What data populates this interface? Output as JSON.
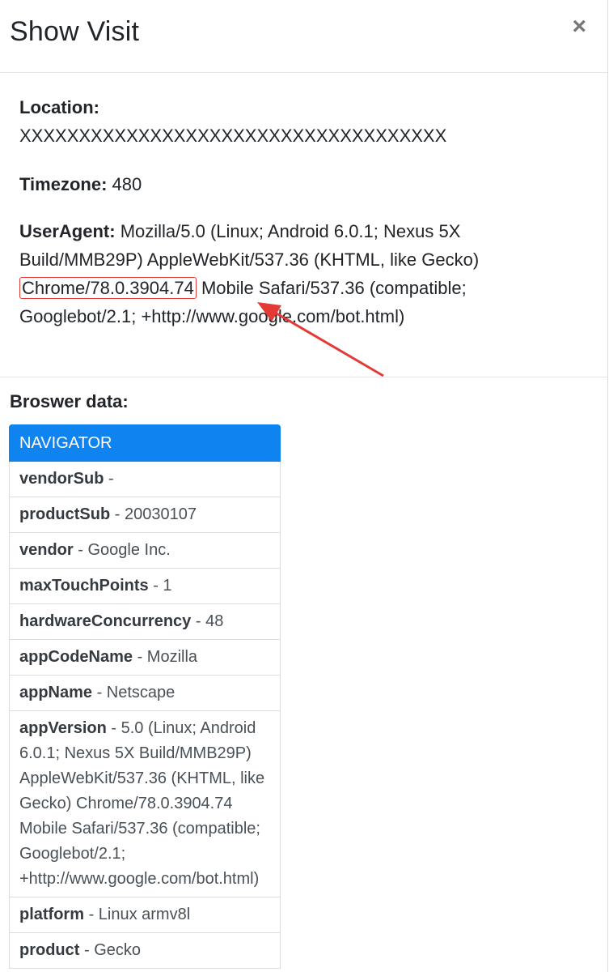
{
  "modal": {
    "title": "Show Visit",
    "close_label": "×"
  },
  "location": {
    "label": "Location:",
    "value": "XXXXXXXXXXXXXXXXXXXXXXXXXXXXXXXXXXXX"
  },
  "timezone": {
    "label": "Timezone:",
    "value": "480"
  },
  "useragent": {
    "label": "UserAgent:",
    "part1": "Mozilla/5.0 (Linux; Android 6.0.1; Nexus 5X Build/MMB29P) AppleWebKit/537.36 (KHTML, like Gecko)",
    "highlight": "Chrome/78.0.3904.74",
    "part2": "Mobile Safari/537.36 (compatible; Googlebot/2.1; +http://www.google.com/bot.html)"
  },
  "browser": {
    "title": "Broswer data:",
    "header": "NAVIGATOR",
    "rows": [
      {
        "key": "vendorSub",
        "value": "-"
      },
      {
        "key": "productSub",
        "value": "- 20030107"
      },
      {
        "key": "vendor",
        "value": "- Google Inc."
      },
      {
        "key": "maxTouchPoints",
        "value": "- 1"
      },
      {
        "key": "hardwareConcurrency",
        "value": "- 48"
      },
      {
        "key": "appCodeName",
        "value": "- Mozilla"
      },
      {
        "key": "appName",
        "value": "- Netscape"
      },
      {
        "key": "appVersion",
        "value": "- 5.0 (Linux; Android 6.0.1; Nexus 5X Build/MMB29P) AppleWebKit/537.36 (KHTML, like Gecko) Chrome/78.0.3904.74 Mobile Safari/537.36 (compatible; Googlebot/2.1; +http://www.google.com/bot.html)"
      },
      {
        "key": "platform",
        "value": "- Linux armv8l"
      },
      {
        "key": "product",
        "value": "- Gecko"
      }
    ]
  },
  "colors": {
    "accent": "#0f83f0",
    "highlight_border": "#e53935",
    "arrow": "#e53935"
  }
}
